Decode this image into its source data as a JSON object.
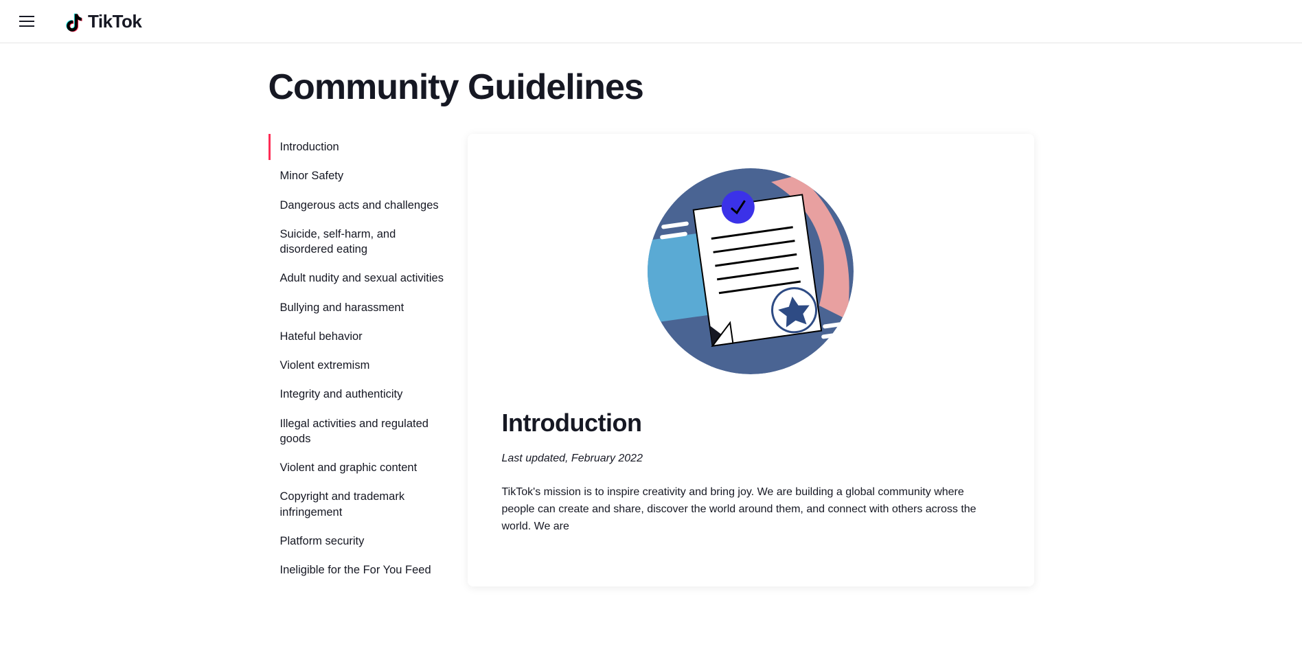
{
  "brand": "TikTok",
  "page_title": "Community Guidelines",
  "sidebar": {
    "items": [
      {
        "label": "Introduction",
        "active": true
      },
      {
        "label": "Minor Safety",
        "active": false
      },
      {
        "label": "Dangerous acts and challenges",
        "active": false
      },
      {
        "label": "Suicide, self-harm, and disordered eating",
        "active": false
      },
      {
        "label": "Adult nudity and sexual activities",
        "active": false
      },
      {
        "label": "Bullying and harassment",
        "active": false
      },
      {
        "label": "Hateful behavior",
        "active": false
      },
      {
        "label": "Violent extremism",
        "active": false
      },
      {
        "label": "Integrity and authenticity",
        "active": false
      },
      {
        "label": "Illegal activities and regulated goods",
        "active": false
      },
      {
        "label": "Violent and graphic content",
        "active": false
      },
      {
        "label": "Copyright and trademark infringement",
        "active": false
      },
      {
        "label": "Platform security",
        "active": false
      },
      {
        "label": "Ineligible for the For You Feed",
        "active": false
      }
    ]
  },
  "content": {
    "heading": "Introduction",
    "last_updated": "Last updated, February 2022",
    "body": "TikTok's mission is to inspire creativity and bring joy. We are building a global community where people can create and share, discover the world around them, and connect with others across the world. We are"
  }
}
